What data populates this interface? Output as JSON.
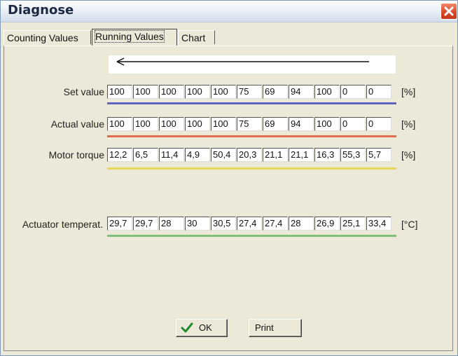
{
  "window": {
    "title": "Diagnose"
  },
  "tabs": [
    {
      "label": "Counting Values"
    },
    {
      "label": "Running Values"
    },
    {
      "label": "Chart"
    }
  ],
  "rows": {
    "set_value": {
      "label": "Set value",
      "values": [
        "100",
        "100",
        "100",
        "100",
        "100",
        "75",
        "69",
        "94",
        "100",
        "0",
        "0"
      ],
      "unit": "[%]",
      "color": "#5e63c2"
    },
    "actual_value": {
      "label": "Actual value",
      "values": [
        "100",
        "100",
        "100",
        "100",
        "100",
        "75",
        "69",
        "94",
        "100",
        "0",
        "0"
      ],
      "unit": "[%]",
      "color": "#e06a4c"
    },
    "motor_torque": {
      "label": "Motor torque",
      "values": [
        "12,2",
        "6,5",
        "11,4",
        "4,9",
        "50,4",
        "20,3",
        "21,1",
        "21,1",
        "16,3",
        "55,3",
        "5,7"
      ],
      "unit": "[%]",
      "color": "#e7d75a"
    },
    "actuator_temp": {
      "label": "Actuator temperat.",
      "values": [
        "29,7",
        "29,7",
        "28",
        "30",
        "30,5",
        "27,4",
        "27,4",
        "28",
        "26,9",
        "25,1",
        "33,4"
      ],
      "unit": "[°C]",
      "color": "#7cc27c"
    }
  },
  "buttons": {
    "ok_label": "OK",
    "print_label": "Print"
  },
  "icons": {
    "close": "close-icon",
    "arrow": "arrow-left-icon",
    "check": "checkmark-icon"
  }
}
